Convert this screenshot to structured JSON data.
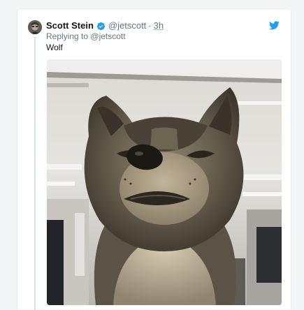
{
  "tweet": {
    "author_name": "Scott Stein",
    "handle": "@jetscott",
    "separator": "·",
    "time": "3h",
    "replying_prefix": "Replying to",
    "replying_handle": "@jetscott",
    "text": "Wolf"
  },
  "icons": {
    "verified": "verified-badge-icon",
    "brand": "twitter-bird-icon"
  },
  "colors": {
    "brand_blue": "#1da1f2",
    "thread_line": "#cfe3f3",
    "secondary_text": "#657786",
    "primary_text": "#14171a"
  }
}
